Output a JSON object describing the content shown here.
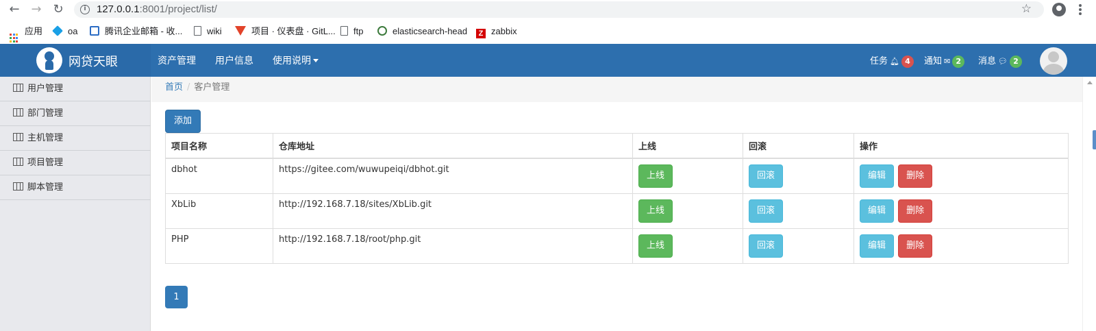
{
  "browser": {
    "back_icon": "←",
    "forward_icon": "→",
    "reload_icon": "↻",
    "info_icon": "i",
    "url_host": "127.0.0.1",
    "url_rest": ":8001/project/list/",
    "star_icon": "☆"
  },
  "bookmarks": [
    {
      "label": "应用",
      "icon": "apps-grid"
    },
    {
      "label": "oa",
      "icon": "cube-icon"
    },
    {
      "label": "腾讯企业邮箱 - 收...",
      "icon": "tencent-mail-icon"
    },
    {
      "label": "wiki",
      "icon": "page-icon"
    },
    {
      "label": "项目 · 仪表盘 · GitL...",
      "icon": "gitlab-icon"
    },
    {
      "label": "ftp",
      "icon": "page-icon"
    },
    {
      "label": "elasticsearch-head",
      "icon": "plugin-icon"
    },
    {
      "label": "zabbix",
      "icon": "zabbix-icon"
    }
  ],
  "header": {
    "brand": "网贷天眼",
    "nav": [
      "资产管理",
      "用户信息",
      "使用说明"
    ],
    "tasks_label": "任务",
    "tasks_count": "4",
    "notices_label": "通知",
    "notices_count": "2",
    "messages_label": "消息",
    "messages_count": "2",
    "colors": {
      "header": "#2d6fae",
      "badge_red": "#d9534f",
      "badge_green": "#5cb85c"
    }
  },
  "sidebar": {
    "items": [
      "用户管理",
      "部门管理",
      "主机管理",
      "项目管理",
      "脚本管理"
    ]
  },
  "breadcrumb": {
    "home": "首页",
    "separator": "/",
    "current": "客户管理"
  },
  "main": {
    "add_label": "添加",
    "columns": [
      "项目名称",
      "仓库地址",
      "上线",
      "回滚",
      "操作"
    ],
    "rows": [
      {
        "name": "dbhot",
        "repo": "https://gitee.com/wuwupeiqi/dbhot.git"
      },
      {
        "name": "XbLib",
        "repo": "http://192.168.7.18/sites/XbLib.git"
      },
      {
        "name": "PHP",
        "repo": "http://192.168.7.18/root/php.git"
      }
    ],
    "online_label": "上线",
    "rollback_label": "回滚",
    "edit_label": "编辑",
    "delete_label": "删除",
    "page": "1"
  }
}
